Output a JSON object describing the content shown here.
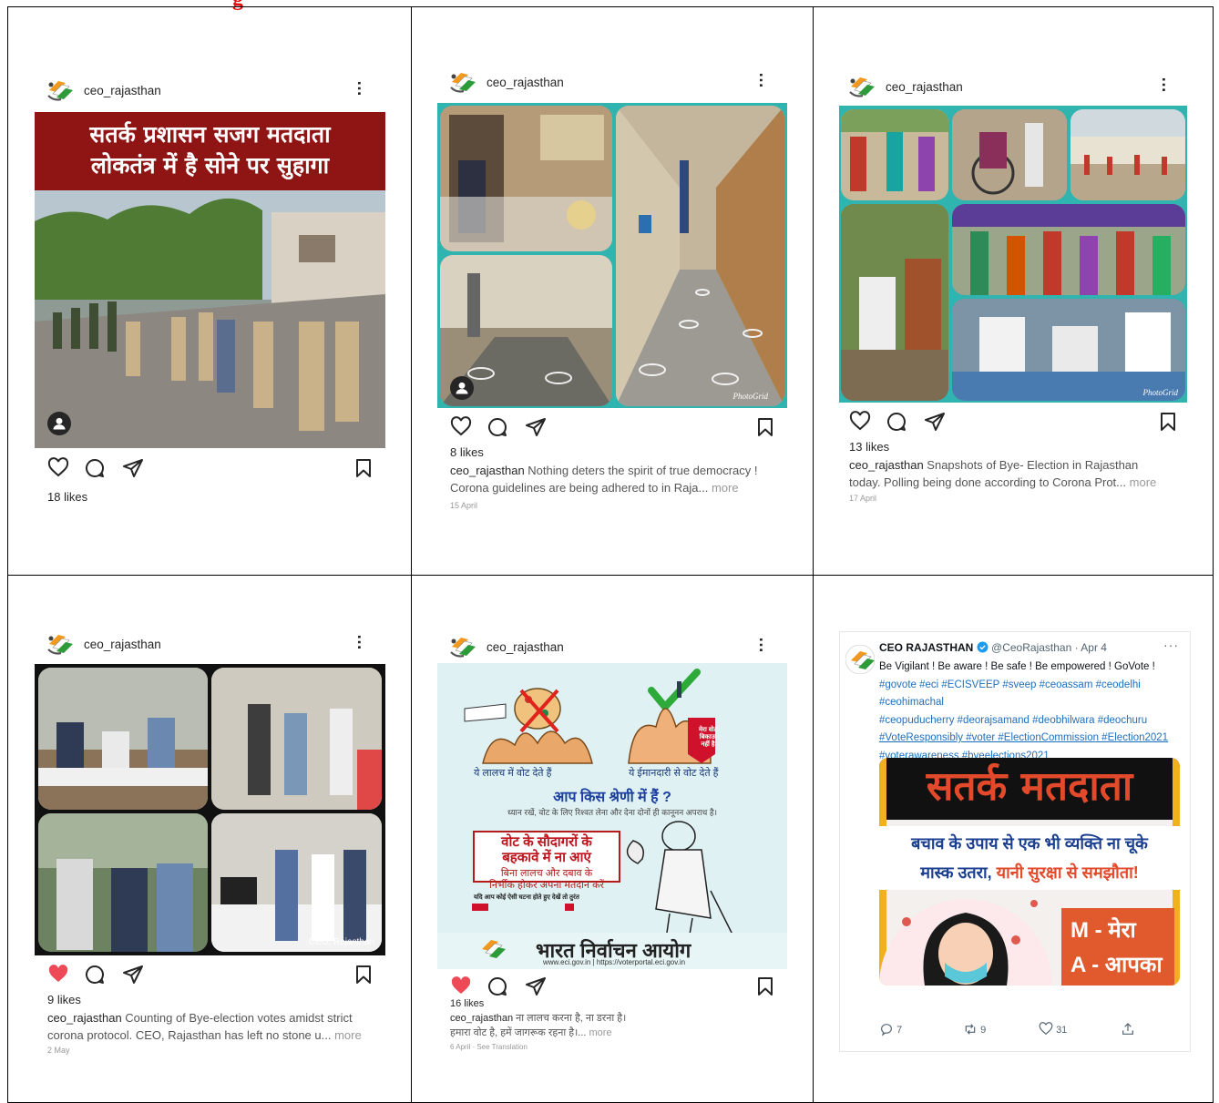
{
  "top_fragment": "g",
  "posts": [
    {
      "username": "ceo_rajasthan",
      "image_headline_line1": "सतर्क प्रशासन सजग मतदाता",
      "image_headline_line2": "लोकतंत्र में है सोने पर सुहागा",
      "likes": "18 likes"
    },
    {
      "username": "ceo_rajasthan",
      "likes": "8 likes",
      "caption_user": "ceo_rajasthan",
      "caption_line1": "Nothing deters the spirit of true democracy !",
      "caption_line2": "Corona guidelines are being adhered to in Raja...",
      "more": "more",
      "date": "15 April",
      "watermark": "PhotoGrid"
    },
    {
      "username": "ceo_rajasthan",
      "likes": "13 likes",
      "caption_user": "ceo_rajasthan",
      "caption_line1": "Snapshots of Bye- Election in Rajasthan",
      "caption_line2": "today. Polling being done according to Corona Prot...",
      "more": "more",
      "date": "17 April",
      "watermark": "PhotoGrid"
    },
    {
      "username": "ceo_rajasthan",
      "likes": "9 likes",
      "caption_user": "ceo_rajasthan",
      "caption_line1": "Counting of Bye-election votes amidst strict",
      "caption_line2": "corona protocol. CEO, Rajasthan has left no stone u...",
      "more": "more",
      "date": "2 May",
      "image_label": "CEO, Rajasthan"
    },
    {
      "username": "ceo_rajasthan",
      "likes": "16 likes",
      "caption_user": "ceo_rajasthan",
      "caption_line1": "ना लालच करना है, ना डरना है।",
      "caption_line2": "हमारा वोट है, हमें जागरूक रहना है।...",
      "more": "more",
      "date": "6 April · See Translation",
      "poster": {
        "left_caption": "ये लालच में वोट देते हैं",
        "right_caption": "ये ईमानदारी से वोट देते हैं",
        "tag_text": "मेरा वोट बिकाऊ नहीं है",
        "question": "आप किस श्रेणी में हैं ?",
        "warning": "ध्यान रखें, वोट के लिए रिश्वत लेना और देना दोनों ही कानूनन अपराध है।",
        "red_line1": "वोट के सौदागरों के",
        "red_line2": "बहकावे में ना आएं",
        "sub_line1": "बिना लालच और दबाव के",
        "sub_line2": "निर्भीक होकर अपना मतदान करें",
        "small_line": "यदि आप कोई ऐसी घटना होते हुए देखें तो तुरंत",
        "eci_name": "भारत निर्वाचन आयोग",
        "eci_url": "www.eci.gov.in  |  https://voterportal.eci.gov.in"
      }
    }
  ],
  "tweet": {
    "name": "CEO RAJASTHAN",
    "handle_date": "@CeoRajasthan · Apr 4",
    "line1": "Be Vigilant ! Be aware ! Be safe ! Be empowered ! GoVote !",
    "line2": "#govote #eci #ECISVEEP #sveep #ceoassam #ceodelhi #ceohimachal",
    "line3": "#ceopuducherry #deorajsamand #deobhilwara #deochuru",
    "line4": "#VoteResponsibly #voter #ElectionCommission #Election2021",
    "line5": "#voterawareness #byeelections2021",
    "img_title": "सतर्क मतदाता",
    "img_line1": "बचाव के उपाय से एक भी व्यक्ति ना चूके",
    "img_line2_a": "मास्क उतरा, ",
    "img_line2_b": "यानी सुरक्षा से समझौता!",
    "acr1": "M - मेरा",
    "acr2": "A - आपका",
    "replies": "7",
    "retweets": "9",
    "likes": "31"
  }
}
